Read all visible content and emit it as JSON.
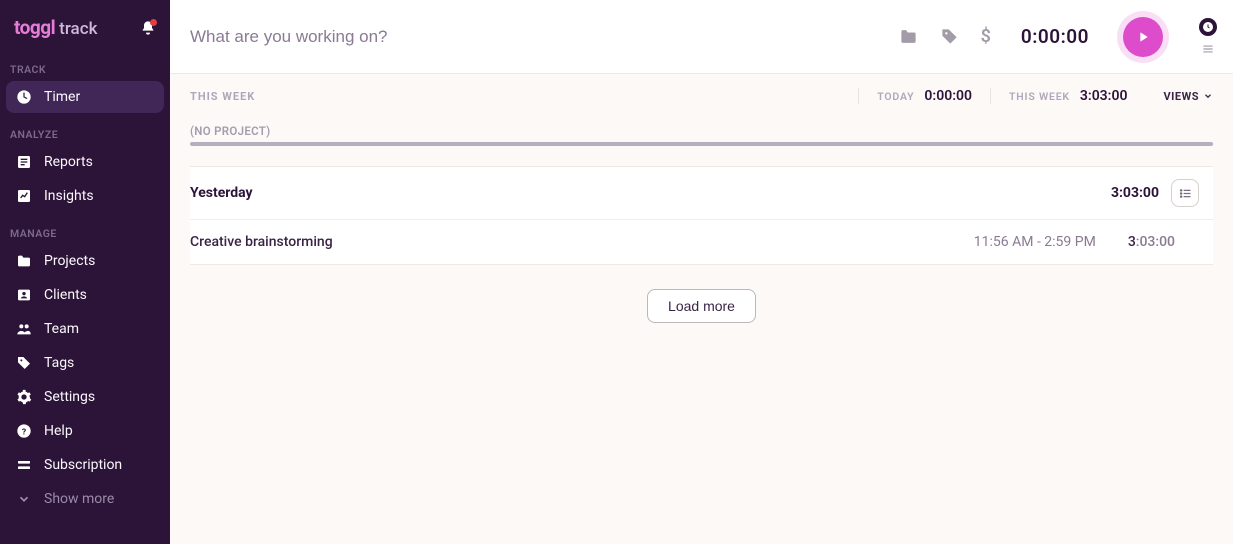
{
  "brand": {
    "main": "toggl",
    "sub": "track"
  },
  "sidebar": {
    "sections": [
      {
        "label": "TRACK",
        "items": [
          {
            "icon": "clock-icon",
            "label": "Timer",
            "active": true
          }
        ]
      },
      {
        "label": "ANALYZE",
        "items": [
          {
            "icon": "list-icon",
            "label": "Reports"
          },
          {
            "icon": "chart-icon",
            "label": "Insights"
          }
        ]
      },
      {
        "label": "MANAGE",
        "items": [
          {
            "icon": "folder-icon",
            "label": "Projects"
          },
          {
            "icon": "person-card-icon",
            "label": "Clients"
          },
          {
            "icon": "team-icon",
            "label": "Team"
          },
          {
            "icon": "tag-icon",
            "label": "Tags"
          },
          {
            "icon": "gear-icon",
            "label": "Settings"
          },
          {
            "icon": "help-icon",
            "label": "Help"
          },
          {
            "icon": "subscription-icon",
            "label": "Subscription"
          }
        ]
      }
    ],
    "show_more": "Show more"
  },
  "timer": {
    "placeholder": "What are you working on?",
    "value": "0:00:00"
  },
  "summary": {
    "this_week_label": "THIS WEEK",
    "today_label": "TODAY",
    "today_value": "0:00:00",
    "week_label": "THIS WEEK",
    "week_value": "3:03:00",
    "views_label": "VIEWS"
  },
  "noproject_label": "(NO PROJECT)",
  "day": {
    "title": "Yesterday",
    "total": "3:03:00"
  },
  "entry": {
    "description": "Creative brainstorming",
    "time_range": "11:56 AM - 2:59 PM",
    "dur_lead": "3",
    "dur_rest": ":03:00"
  },
  "load_more": "Load more"
}
